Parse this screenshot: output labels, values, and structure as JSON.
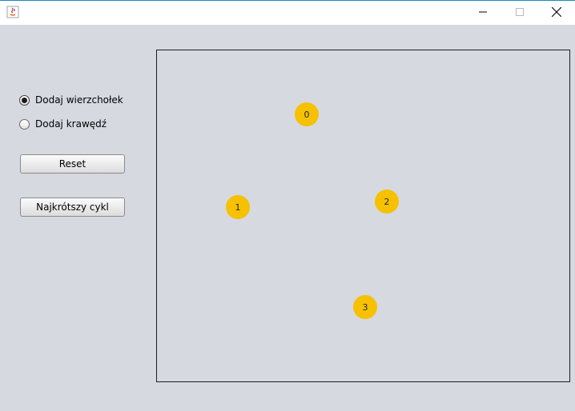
{
  "window": {
    "title": "",
    "controls": [
      "minimize-icon",
      "maximize-icon",
      "close-icon"
    ]
  },
  "controls": {
    "radio_add_vertex": {
      "label": "Dodaj wierzchołek",
      "checked": true
    },
    "radio_add_edge": {
      "label": "Dodaj krawędź",
      "checked": false
    },
    "reset_label": "Reset",
    "shortest_cycle_label": "Najkrótszy cykl"
  },
  "graph": {
    "vertices": [
      {
        "label": "0"
      },
      {
        "label": "1"
      },
      {
        "label": "2"
      },
      {
        "label": "3"
      }
    ],
    "vertex_color": "#f6c100"
  },
  "colors": {
    "background": "#d6d9df",
    "accent": "#f6c100"
  }
}
